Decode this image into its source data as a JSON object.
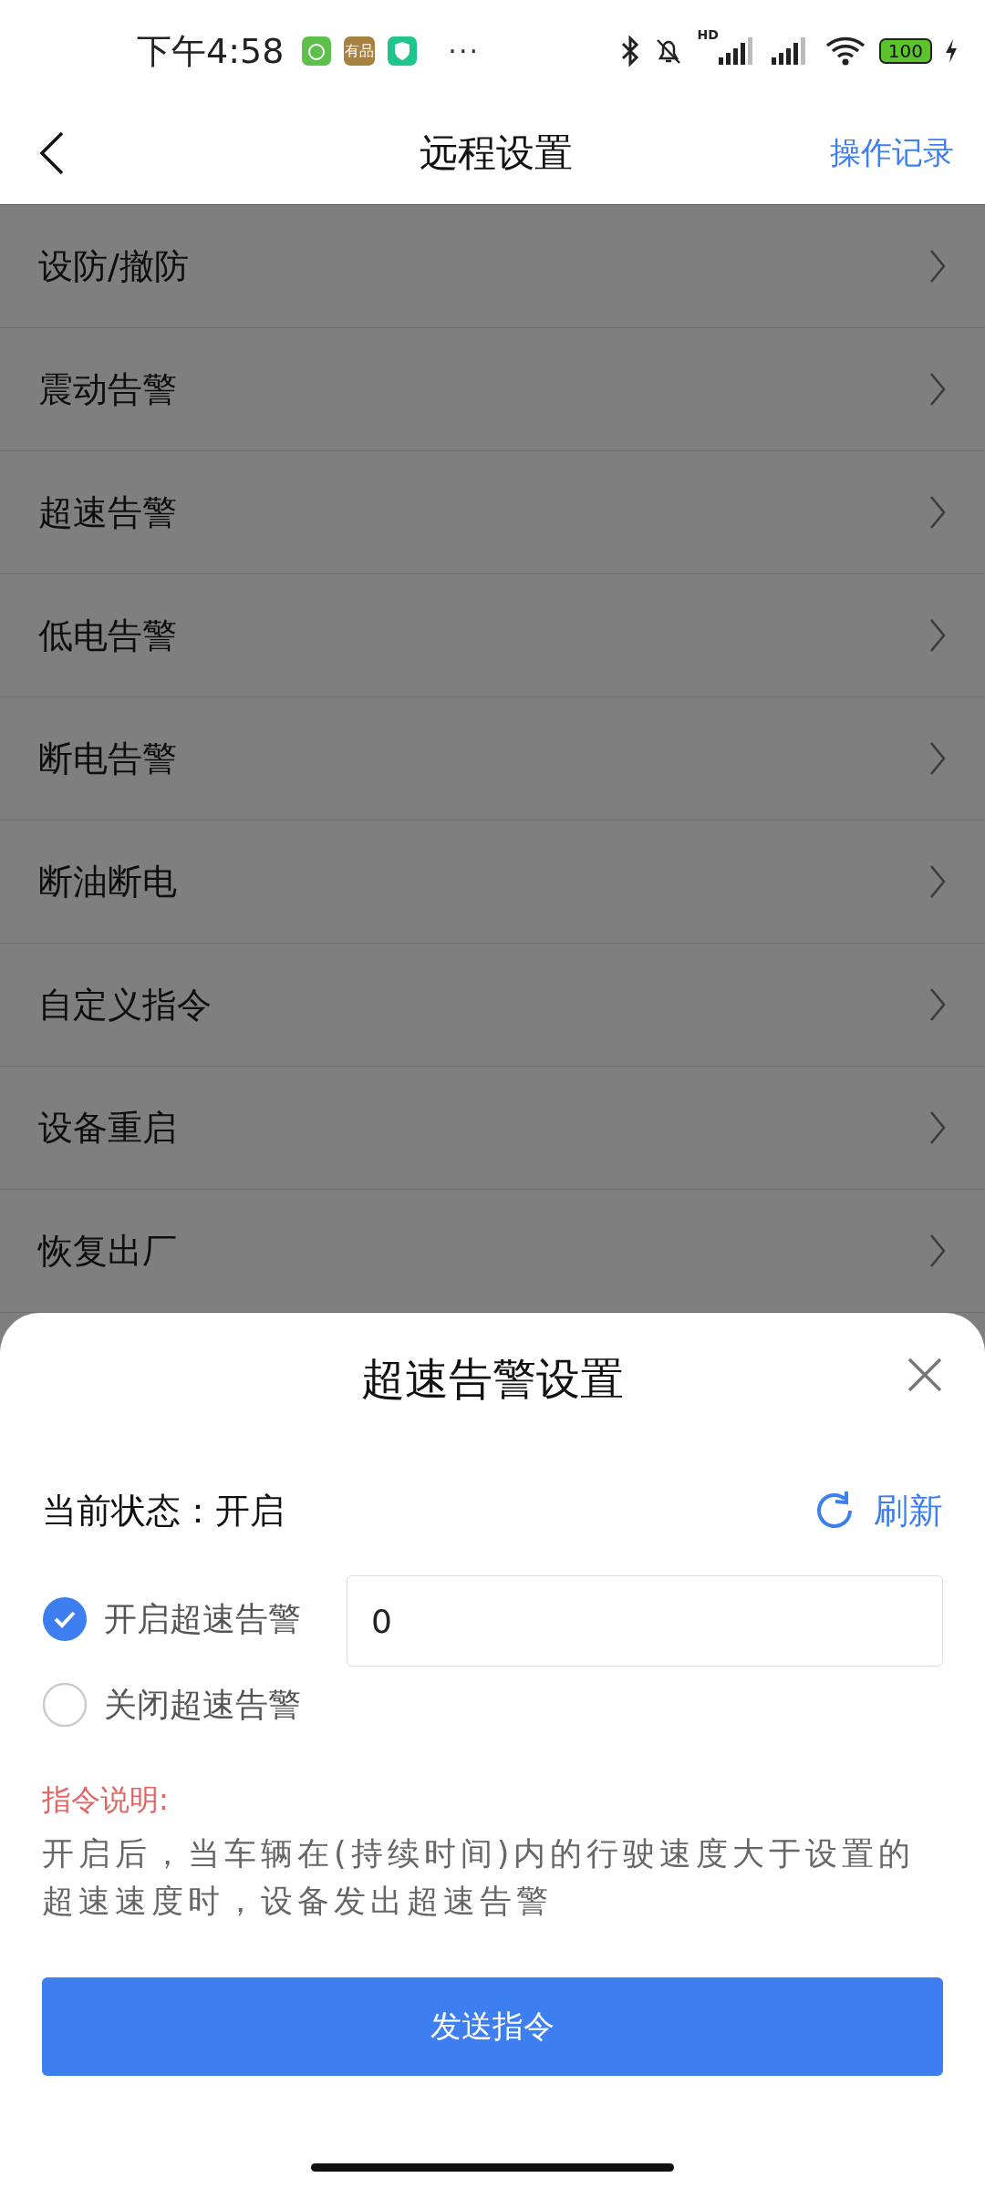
{
  "status_bar": {
    "time": "下午4:58",
    "app_label": "有品",
    "more": "···",
    "network": "HD",
    "battery": "100"
  },
  "nav": {
    "title": "远程设置",
    "action": "操作记录"
  },
  "menu_items": [
    {
      "label": "设防/撤防"
    },
    {
      "label": "震动告警"
    },
    {
      "label": "超速告警"
    },
    {
      "label": "低电告警"
    },
    {
      "label": "断电告警"
    },
    {
      "label": "断油断电"
    },
    {
      "label": "自定义指令"
    },
    {
      "label": "设备重启"
    },
    {
      "label": "恢复出厂"
    }
  ],
  "sheet": {
    "title": "超速告警设置",
    "status": "当前状态：开启",
    "refresh": "刷新",
    "options": [
      {
        "label": "开启超速告警",
        "selected": true
      },
      {
        "label": "关闭超速告警",
        "selected": false
      }
    ],
    "speed_value": "0",
    "note_title": "指令说明:",
    "note_text": "开启后，当车辆在(持续时间)内的行驶速度大于设置的超速速度时，设备发出超速告警",
    "send": "发送指令"
  }
}
